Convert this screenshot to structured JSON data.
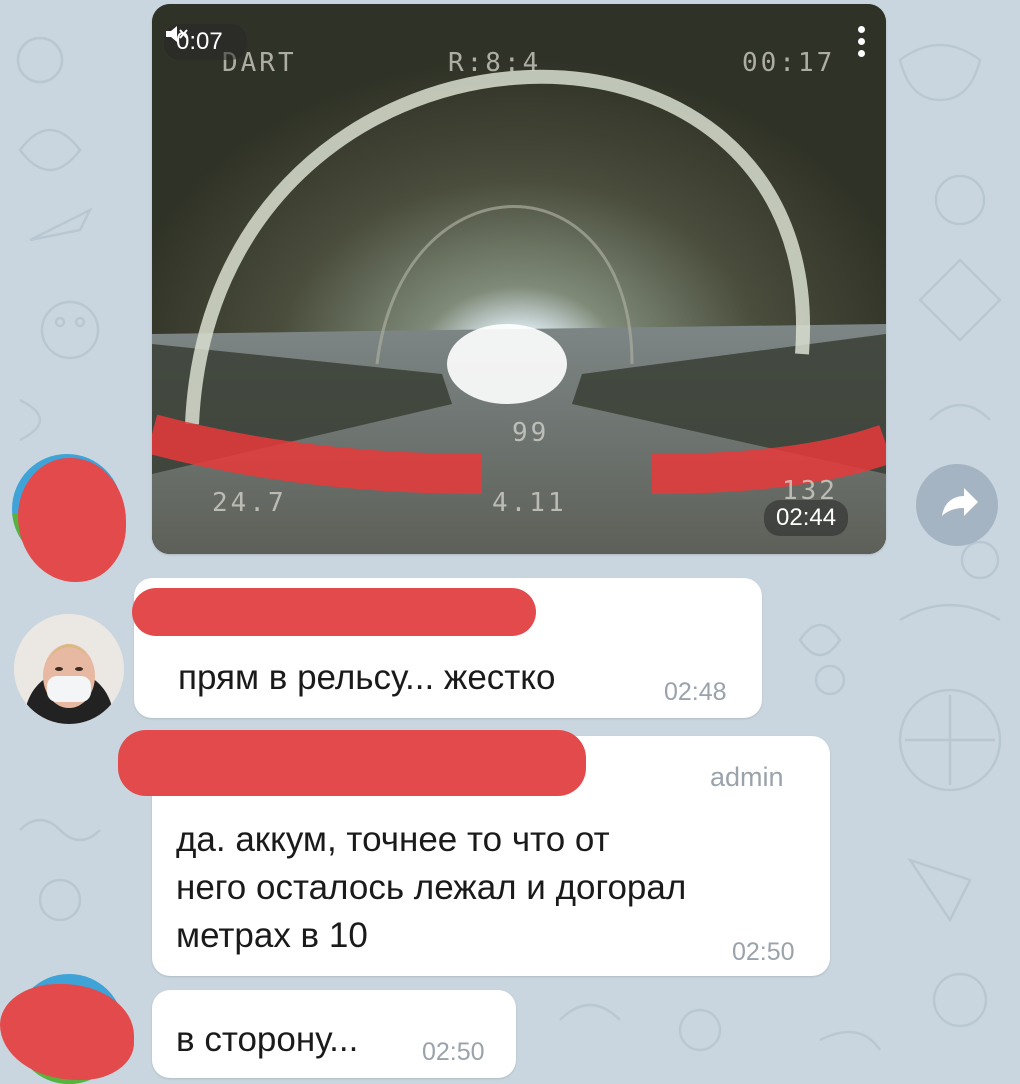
{
  "video": {
    "elapsed": "0:07",
    "sent_time": "02:44",
    "muted_icon": "speaker-muted-icon",
    "osd": {
      "top_left": "DART",
      "top_center": "R:8:4",
      "top_right": "00:17",
      "center": "99",
      "bottom_left": "24.7",
      "bottom_center": "4.11",
      "bottom_right": "132"
    }
  },
  "share_icon": "share-arrow-icon",
  "messages": [
    {
      "text": "прям в рельсу... жестко",
      "time": "02:48"
    },
    {
      "badge": "admin",
      "lines": [
        "да. аккум, точнее то что от",
        "него осталось лежал и догорал",
        "метрах в 10"
      ],
      "time": "02:50"
    },
    {
      "text": "в сторону...",
      "time": "02:50"
    }
  ],
  "colors": {
    "redaction": "#e34a4c",
    "chat_bg": "#c9d6df",
    "bubble": "#ffffff",
    "meta": "#9aa3ab"
  }
}
